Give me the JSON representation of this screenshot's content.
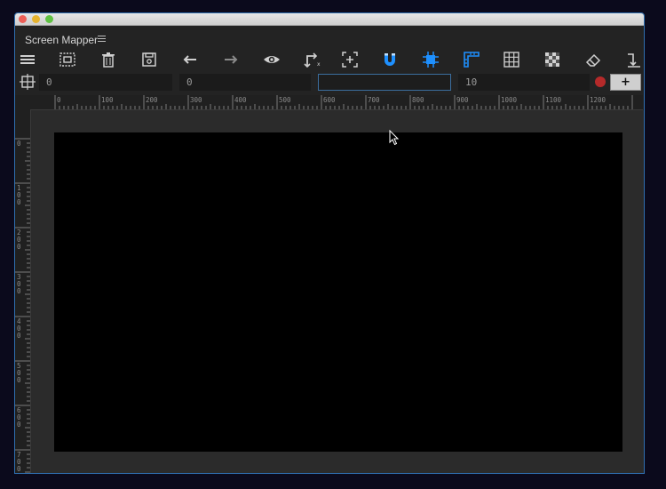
{
  "app": {
    "panel_title": "Screen Mapper"
  },
  "icons": {
    "panel_menu": "hamburger-menu-icon",
    "accent_color": "#1e90ff"
  },
  "toolbar": {
    "tools": [
      {
        "name": "hamburger-menu-icon"
      },
      {
        "name": "select-all-icon"
      },
      {
        "name": "trash-icon"
      },
      {
        "name": "save-icon"
      },
      {
        "name": "arrow-left-icon"
      },
      {
        "name": "arrow-right-icon"
      },
      {
        "name": "eye-icon"
      },
      {
        "name": "transform-icon"
      },
      {
        "name": "add-frame-icon"
      },
      {
        "name": "magnet-icon",
        "active": true
      },
      {
        "name": "chip-icon",
        "active": true
      },
      {
        "name": "ruler-icon",
        "active": true
      },
      {
        "name": "grid-icon"
      },
      {
        "name": "checkerboard-icon"
      },
      {
        "name": "eraser-icon"
      },
      {
        "name": "corner-arrow-icon"
      }
    ]
  },
  "fields": {
    "x_value": "0",
    "y_value": "0",
    "name_value": "",
    "grid_value": "10",
    "add_label": "+"
  },
  "ruler": {
    "h_labels": [
      "0",
      "100",
      "200",
      "300",
      "400",
      "500",
      "600",
      "700",
      "800",
      "900",
      "1000",
      "1100",
      "1200"
    ],
    "v_labels": [
      "0",
      "100",
      "200",
      "300",
      "400",
      "500",
      "600",
      "700"
    ]
  }
}
